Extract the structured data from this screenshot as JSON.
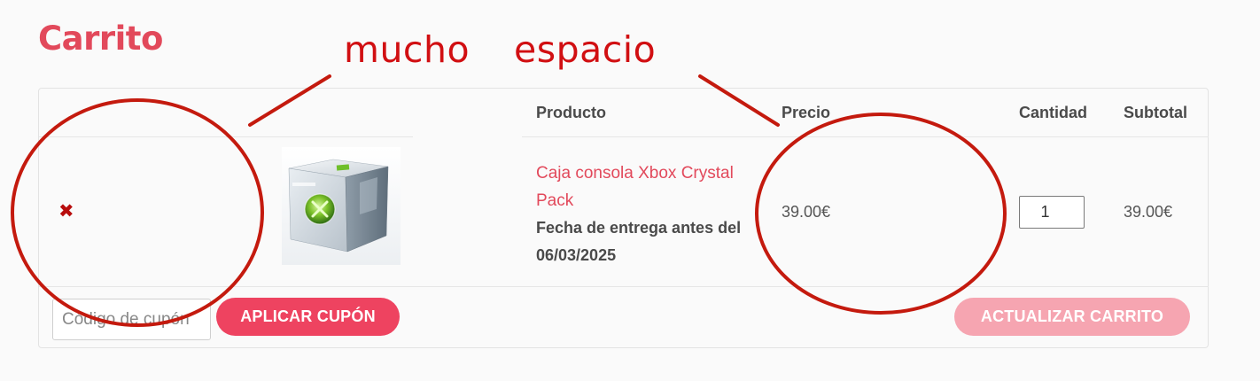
{
  "page": {
    "title": "Carrito"
  },
  "annotation": {
    "word1": "mucho",
    "word2": "espacio",
    "color": "#d10f12"
  },
  "cart": {
    "columns": {
      "product": "Producto",
      "price": "Precio",
      "quantity": "Cantidad",
      "subtotal": "Subtotal"
    },
    "items": [
      {
        "remove_icon": "close-icon",
        "image_icon": "xbox-crystal-box",
        "name": "Caja consola Xbox Crystal Pack",
        "delivery": "Fecha de entrega antes del 06/03/2025",
        "price": "39.00€",
        "quantity": "1",
        "subtotal": "39.00€"
      }
    ],
    "coupon": {
      "placeholder": "Código de cupón"
    },
    "apply_coupon_label": "APLICAR CUPÓN",
    "update_cart_label": "ACTUALIZAR CARRITO"
  },
  "colors": {
    "brand": "#e2495b",
    "button_primary": "#ee4360",
    "button_disabled": "#f6a5b1",
    "remove": "#b80d0d"
  }
}
